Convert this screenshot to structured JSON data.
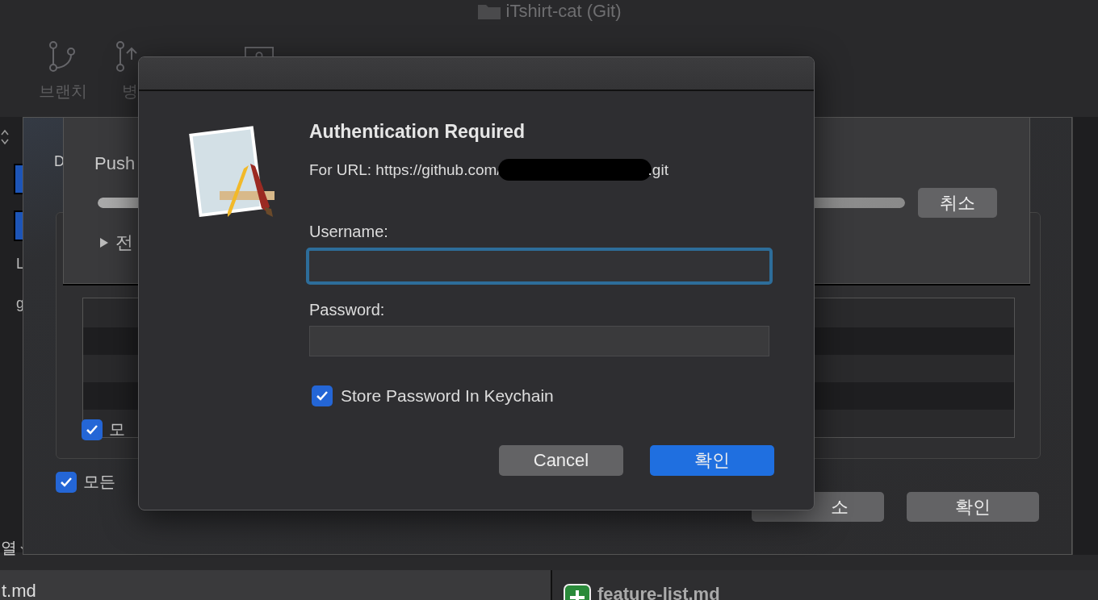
{
  "window": {
    "title": "iTshirt-cat (Git)"
  },
  "toolbar": [
    {
      "kind": "branch",
      "label": "브랜치"
    },
    {
      "kind": "merge",
      "label": "병"
    },
    {
      "kind": "box"
    }
  ],
  "sidebar": {
    "letters": [
      "L",
      "g"
    ],
    "footer": "열"
  },
  "files": [
    {
      "name": "t.md",
      "kind": "plain"
    },
    {
      "name": "feature-list.md",
      "kind": "added"
    }
  ],
  "push_sheet": {
    "label": "D",
    "checkboxes": [
      {
        "label": "모",
        "checked": true
      },
      {
        "label": "모든",
        "checked": true
      }
    ],
    "buttons": [
      {
        "label": "소",
        "default": false
      },
      {
        "label": "확인",
        "default": false
      }
    ]
  },
  "progress_sheet": {
    "title": "Push",
    "level": 1,
    "cancel": "취소",
    "disclosure": {
      "label": "전",
      "expanded": false
    }
  },
  "dialog": {
    "title": "Authentication Required",
    "url_prefix": "For URL: https://github.com/",
    "url_suffix": ".git",
    "redacted": true,
    "fields": [
      {
        "label": "Username:",
        "focused": true
      },
      {
        "label": "Password:",
        "focused": false
      }
    ],
    "keychain": {
      "label": "Store Password In Keychain",
      "checked": true
    },
    "buttons": [
      {
        "label": "Cancel",
        "default": false
      },
      {
        "label": "확인",
        "default": true
      }
    ]
  }
}
